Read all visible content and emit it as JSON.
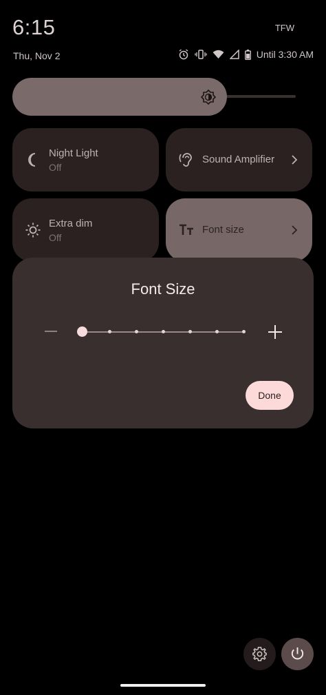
{
  "status_bar": {
    "time": "6:15",
    "carrier": "TFW",
    "date": "Thu, Nov 2",
    "alarm_text": "Until 3:30 AM",
    "icons": [
      "alarm-icon",
      "vibrate-icon",
      "wifi-icon",
      "signal-icon",
      "battery-icon"
    ]
  },
  "brightness": {
    "icon": "brightness-icon",
    "level_percent": 70
  },
  "tiles": [
    {
      "title": "Night Light",
      "subtitle": "Off",
      "icon": "moon-icon"
    },
    {
      "title": "Sound Amplifier",
      "icon": "ear-icon",
      "has_chevron": true
    },
    {
      "title": "Extra dim",
      "subtitle": "Off",
      "icon": "sun-icon"
    },
    {
      "title": "Font size",
      "icon": "text-size-icon",
      "has_chevron": true,
      "active": true
    }
  ],
  "dialog": {
    "title": "Font Size",
    "slider_steps": 7,
    "selected_step": 1,
    "done_label": "Done",
    "decrease_icon": "minus-icon",
    "increase_icon": "plus-icon"
  },
  "bottom": {
    "settings_icon": "gear-icon",
    "power_icon": "power-icon"
  },
  "colors": {
    "background": "#000000",
    "tile": "#2b2121",
    "tile_active": "#786767",
    "dialog": "#3a2f2f",
    "accent": "#fcdada"
  }
}
